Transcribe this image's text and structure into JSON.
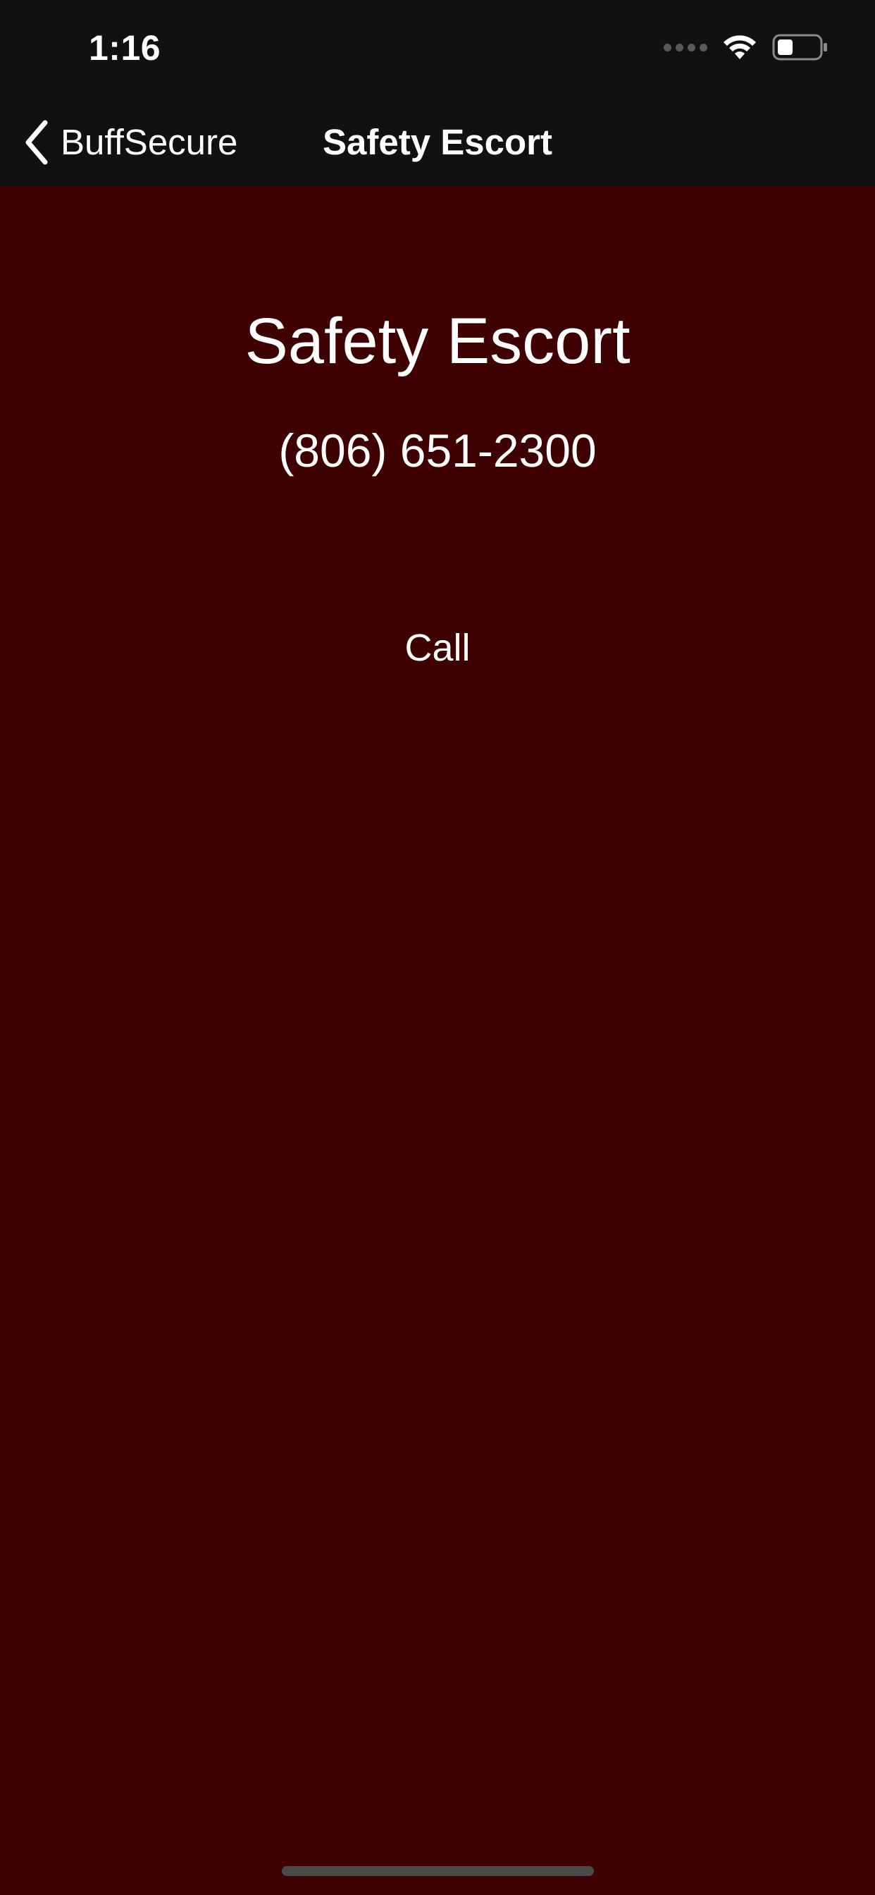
{
  "status_bar": {
    "time": "1:16"
  },
  "nav": {
    "back_label": "BuffSecure",
    "title": "Safety Escort"
  },
  "main": {
    "heading": "Safety Escort",
    "phone_number": "(806) 651-2300",
    "call_label": "Call"
  },
  "icons": {
    "back": "chevron-left-icon",
    "signal": "signal-dots-icon",
    "wifi": "wifi-icon",
    "battery": "battery-icon"
  },
  "colors": {
    "background": "#3f0002",
    "bar": "#111111",
    "text": "#ffffff"
  }
}
